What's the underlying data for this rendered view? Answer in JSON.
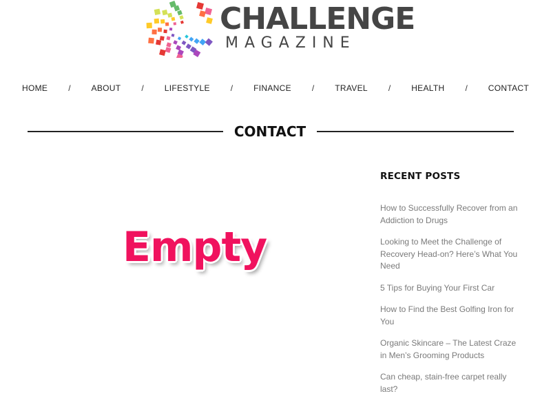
{
  "logo": {
    "title": "CHALLENGE",
    "subtitle": "MAGAZINE",
    "mark_colors": [
      "#e53935",
      "#f06292",
      "#ab47bc",
      "#7e57c2",
      "#42a5f5",
      "#26c6da",
      "#66bb6a",
      "#d4e157",
      "#ffca28",
      "#ff7043"
    ]
  },
  "nav": {
    "items": [
      {
        "label": "HOME"
      },
      {
        "label": "ABOUT"
      },
      {
        "label": "LIFESTYLE"
      },
      {
        "label": "FINANCE"
      },
      {
        "label": "TRAVEL"
      },
      {
        "label": "HEALTH"
      },
      {
        "label": "CONTACT"
      }
    ],
    "separator": "/"
  },
  "page": {
    "heading": "CONTACT",
    "empty_label": "Empty"
  },
  "sidebar": {
    "title": "RECENT POSTS",
    "posts": [
      {
        "title": "How to Successfully Recover from an Addiction to Drugs"
      },
      {
        "title": "Looking to Meet the Challenge of Recovery Head-on? Here’s What You Need"
      },
      {
        "title": "5 Tips for Buying Your First Car"
      },
      {
        "title": "How to Find the Best Golfing Iron for You"
      },
      {
        "title": "Organic Skincare – The Latest Craze in Men’s Grooming Products"
      },
      {
        "title": "Can cheap, stain-free carpet really last?"
      }
    ]
  },
  "colors": {
    "text_dark": "#222222",
    "logo_text": "#454545",
    "sticker": "#f0125e",
    "post_link": "#7a7a7a"
  }
}
